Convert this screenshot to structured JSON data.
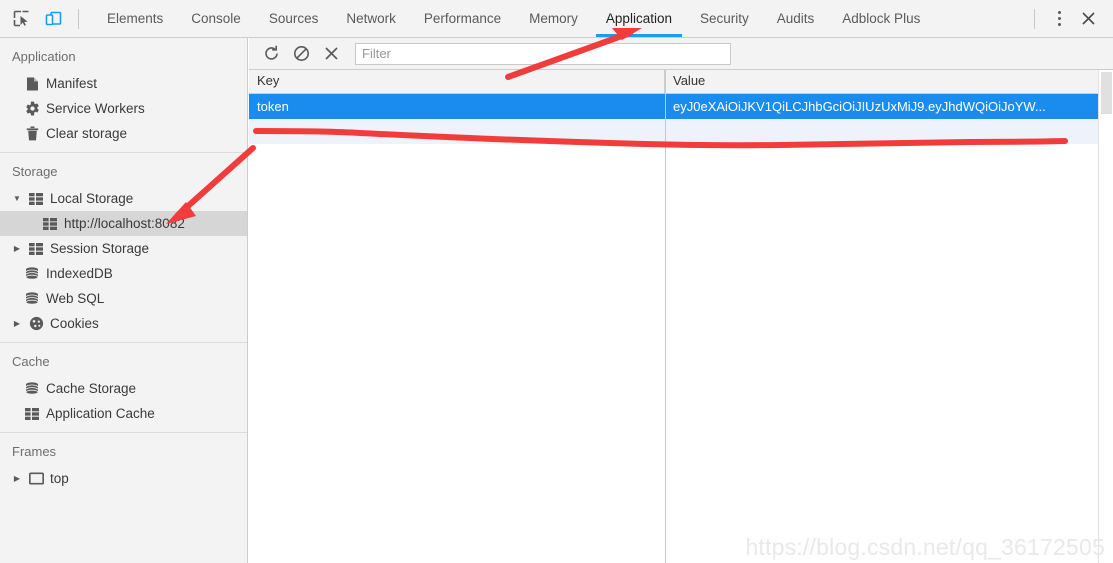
{
  "toolbar": {
    "inspect_icon": "inspect-element-icon",
    "device_icon": "device-toolbar-icon",
    "more_icon": "more-options-icon",
    "close_icon": "close-icon",
    "accent_color": "#1a9cf0",
    "device_icon_color": "#1a9cf0"
  },
  "tabs": [
    {
      "label": "Elements",
      "active": false
    },
    {
      "label": "Console",
      "active": false
    },
    {
      "label": "Sources",
      "active": false
    },
    {
      "label": "Network",
      "active": false
    },
    {
      "label": "Performance",
      "active": false
    },
    {
      "label": "Memory",
      "active": false
    },
    {
      "label": "Application",
      "active": true
    },
    {
      "label": "Security",
      "active": false
    },
    {
      "label": "Audits",
      "active": false
    },
    {
      "label": "Adblock Plus",
      "active": false
    }
  ],
  "sidebar": {
    "sections": [
      {
        "title": "Application",
        "items": [
          {
            "label": "Manifest",
            "icon": "manifest-document-icon",
            "triangle": "none",
            "selected": false,
            "indent": 1
          },
          {
            "label": "Service Workers",
            "icon": "gear-icon",
            "triangle": "none",
            "selected": false,
            "indent": 1
          },
          {
            "label": "Clear storage",
            "icon": "trash-icon",
            "triangle": "none",
            "selected": false,
            "indent": 1
          }
        ]
      },
      {
        "title": "Storage",
        "items": [
          {
            "label": "Local Storage",
            "icon": "table-grid-icon",
            "triangle": "expanded",
            "selected": false,
            "indent": 0
          },
          {
            "label": "http://localhost:8082",
            "icon": "table-grid-icon",
            "triangle": "none",
            "selected": true,
            "indent": 2
          },
          {
            "label": "Session Storage",
            "icon": "table-grid-icon",
            "triangle": "collapsed",
            "selected": false,
            "indent": 0
          },
          {
            "label": "IndexedDB",
            "icon": "database-icon",
            "triangle": "none",
            "selected": false,
            "indent": 1
          },
          {
            "label": "Web SQL",
            "icon": "database-icon",
            "triangle": "none",
            "selected": false,
            "indent": 1
          },
          {
            "label": "Cookies",
            "icon": "cookie-icon",
            "triangle": "collapsed",
            "selected": false,
            "indent": 0
          }
        ]
      },
      {
        "title": "Cache",
        "items": [
          {
            "label": "Cache Storage",
            "icon": "database-icon",
            "triangle": "none",
            "selected": false,
            "indent": 1
          },
          {
            "label": "Application Cache",
            "icon": "table-grid-icon",
            "triangle": "none",
            "selected": false,
            "indent": 1
          }
        ]
      },
      {
        "title": "Frames",
        "items": [
          {
            "label": "top",
            "icon": "frame-window-icon",
            "triangle": "collapsed",
            "selected": false,
            "indent": 0
          }
        ]
      }
    ]
  },
  "panel": {
    "refresh_icon": "refresh-icon",
    "clear_icon": "clear-all-icon",
    "delete_icon": "delete-selected-icon",
    "filter_placeholder": "Filter",
    "filter_value": "",
    "columns": [
      "Key",
      "Value"
    ],
    "rows": [
      {
        "key": "token",
        "value": "eyJ0eXAiOiJKV1QiLCJhbGciOiJIUzUxMiJ9.eyJhdWQiOiJoYW...",
        "selected": true
      },
      {
        "key": "",
        "value": "",
        "selected": false
      }
    ]
  },
  "annotations": {
    "color": "#f23c3c",
    "arrow_to_application_tab": "red-arrow-pointing-to-application-tab",
    "arrow_to_local_storage": "red-arrow-pointing-to-local-storage",
    "underline_second_row": "red-underline-stroke"
  },
  "watermark": {
    "text": "https://blog.csdn.net/qq_36172505"
  }
}
